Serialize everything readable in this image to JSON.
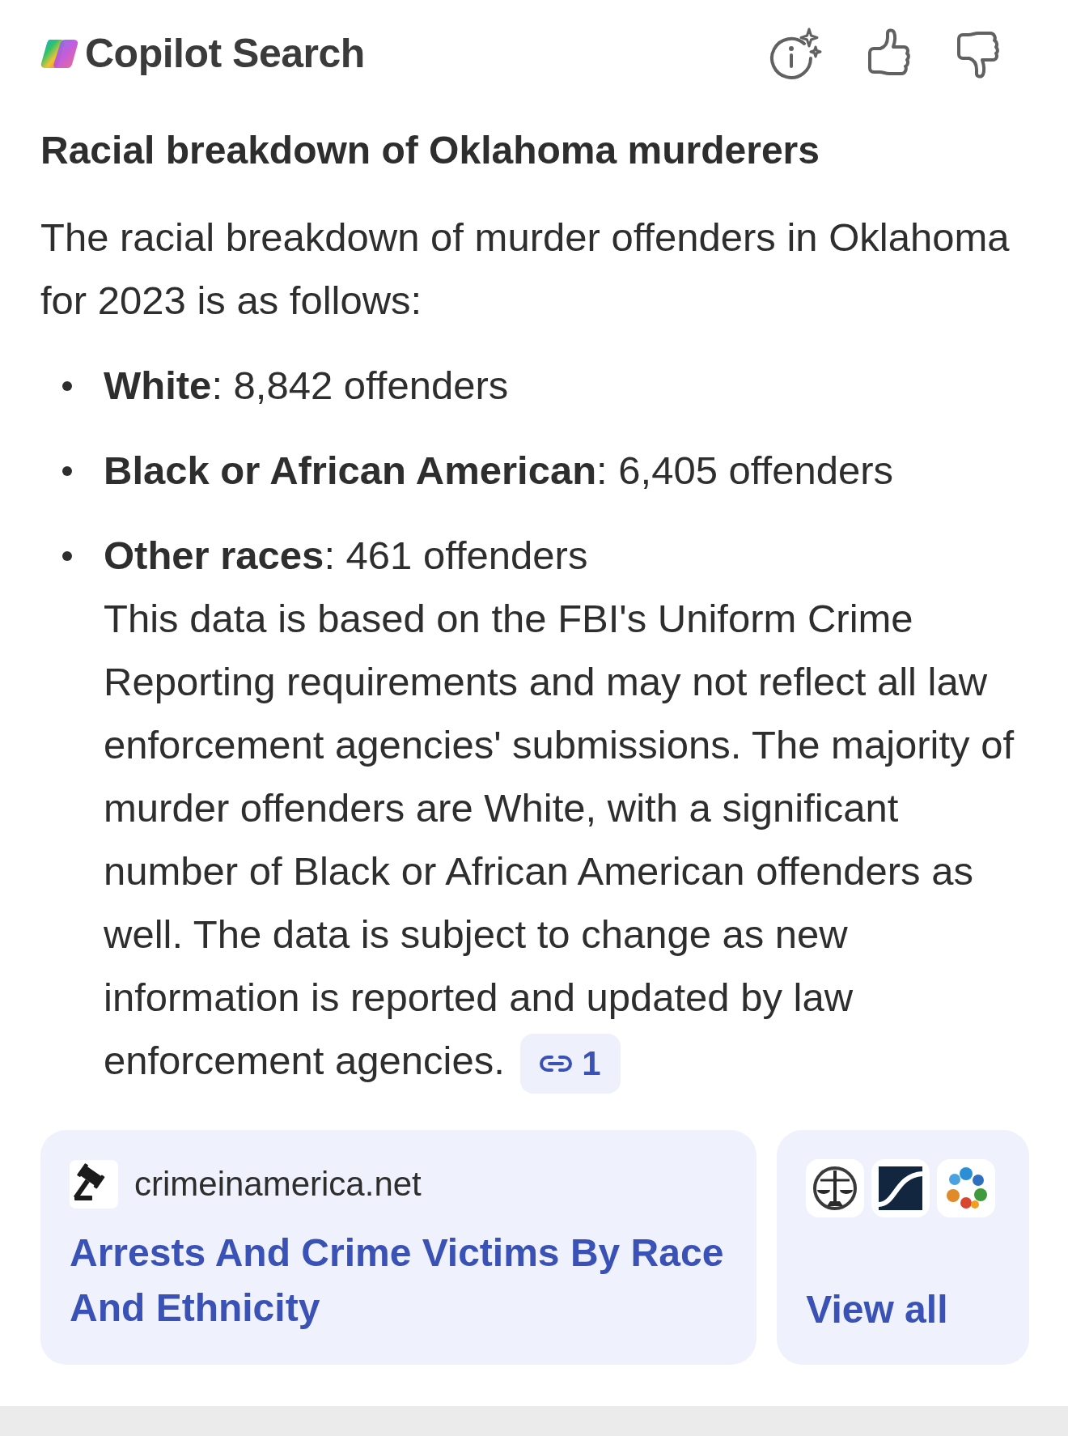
{
  "header": {
    "title": "Copilot Search"
  },
  "question": "Racial breakdown of Oklahoma murderers",
  "answer": {
    "intro": "The racial breakdown of murder offenders in Oklahoma for 2023 is as follows:",
    "items": [
      {
        "text": "**White**: 8,842 offenders"
      },
      {
        "text": "**Black or African American**: 6,405 offenders"
      },
      {
        "text": "**Other races**: 461 offenders",
        "note": "This data is based on the FBI's Uniform Crime Reporting requirements and may not reflect all law enforcement agencies' submissions. The majority of murder offenders are White, with a significant number of Black or African American offenders as well. The data is subject to change as new information is reported and updated by law enforcement agencies.",
        "citation": "1"
      }
    ]
  },
  "sources": {
    "card": {
      "domain": "crimeinamerica.net",
      "title": "Arrests And Crime Victims By Race And Ethnicity"
    },
    "more": {
      "label": "View all"
    }
  }
}
